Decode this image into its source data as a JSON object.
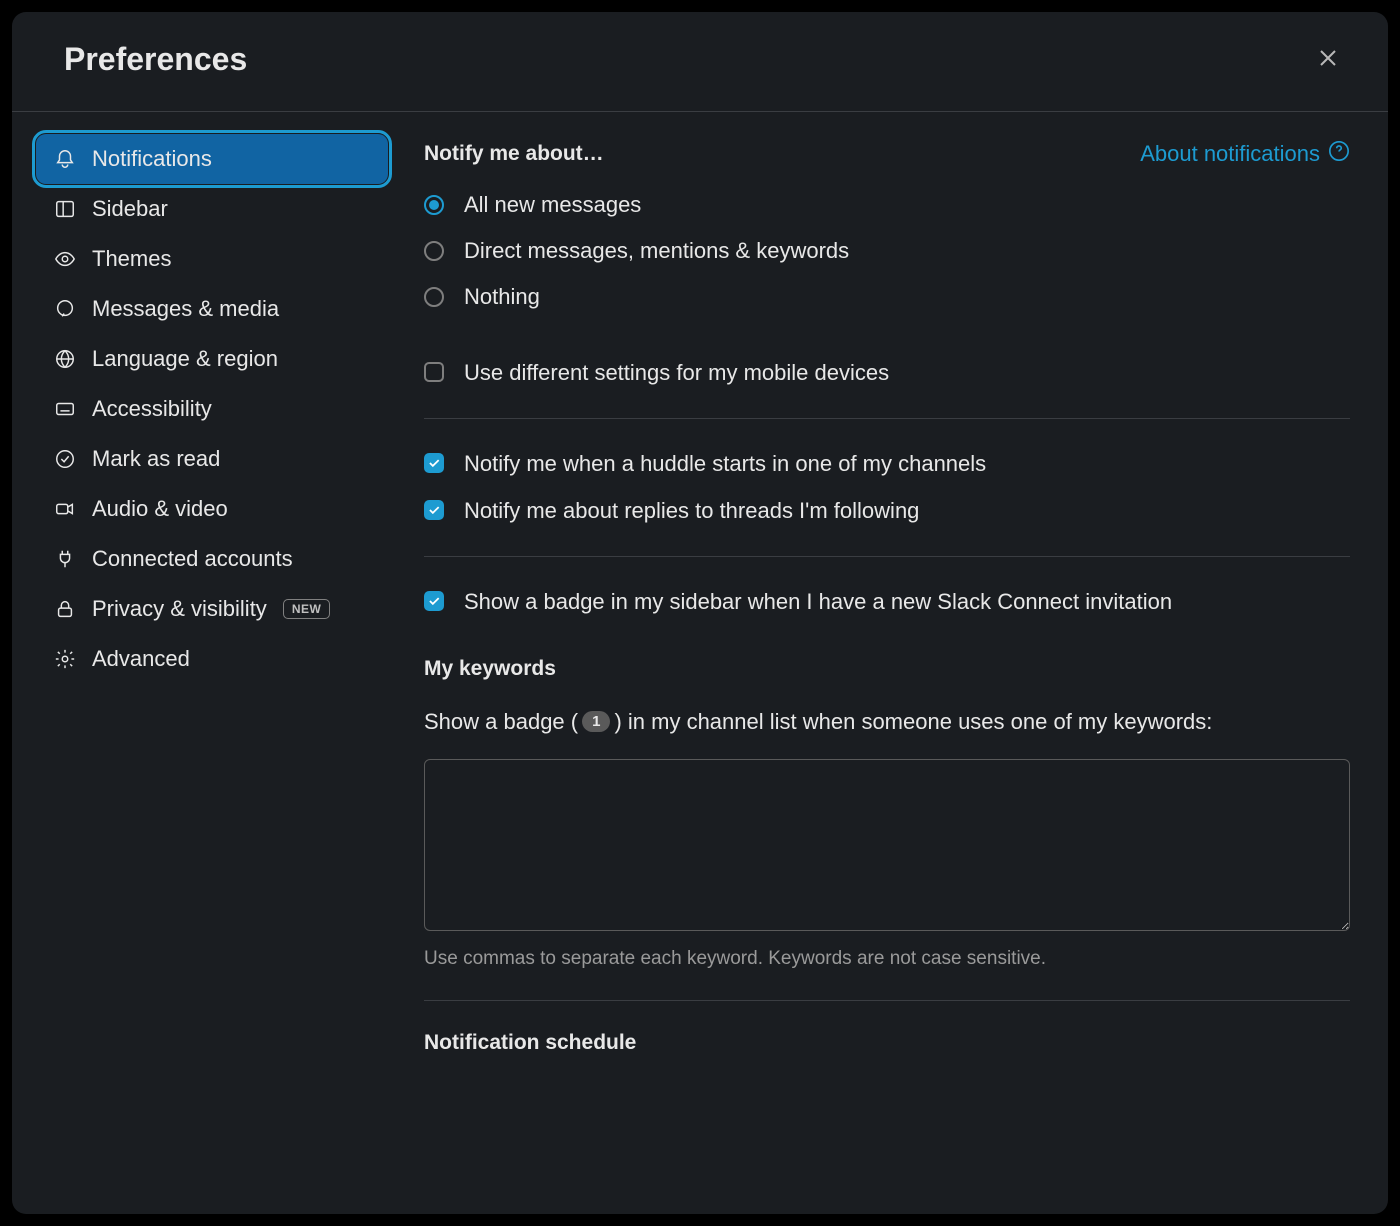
{
  "header": {
    "title": "Preferences"
  },
  "sidebar": {
    "items": [
      {
        "label": "Notifications",
        "badge": null,
        "active": true
      },
      {
        "label": "Sidebar",
        "badge": null,
        "active": false
      },
      {
        "label": "Themes",
        "badge": null,
        "active": false
      },
      {
        "label": "Messages & media",
        "badge": null,
        "active": false
      },
      {
        "label": "Language & region",
        "badge": null,
        "active": false
      },
      {
        "label": "Accessibility",
        "badge": null,
        "active": false
      },
      {
        "label": "Mark as read",
        "badge": null,
        "active": false
      },
      {
        "label": "Audio & video",
        "badge": null,
        "active": false
      },
      {
        "label": "Connected accounts",
        "badge": null,
        "active": false
      },
      {
        "label": "Privacy & visibility",
        "badge": "NEW",
        "active": false
      },
      {
        "label": "Advanced",
        "badge": null,
        "active": false
      }
    ]
  },
  "content": {
    "notify_section_title": "Notify me about…",
    "about_link": "About notifications",
    "radio_options": [
      {
        "label": "All new messages",
        "selected": true
      },
      {
        "label": "Direct messages, mentions & keywords",
        "selected": false
      },
      {
        "label": "Nothing",
        "selected": false
      }
    ],
    "mobile_checkbox": {
      "label": "Use different settings for my mobile devices",
      "checked": false
    },
    "huddle_checkbox": {
      "label": "Notify me when a huddle starts in one of my channels",
      "checked": true
    },
    "threads_checkbox": {
      "label": "Notify me about replies to threads I'm following",
      "checked": true
    },
    "slack_connect_checkbox": {
      "label": "Show a badge in my sidebar when I have a new Slack Connect invitation",
      "checked": true
    },
    "keywords": {
      "title": "My keywords",
      "desc_prefix": "Show a badge (",
      "badge_value": "1",
      "desc_suffix": ") in my channel list when someone uses one of my keywords:",
      "textarea_value": "",
      "hint": "Use commas to separate each keyword. Keywords are not case sensitive."
    },
    "schedule": {
      "title": "Notification schedule"
    }
  }
}
